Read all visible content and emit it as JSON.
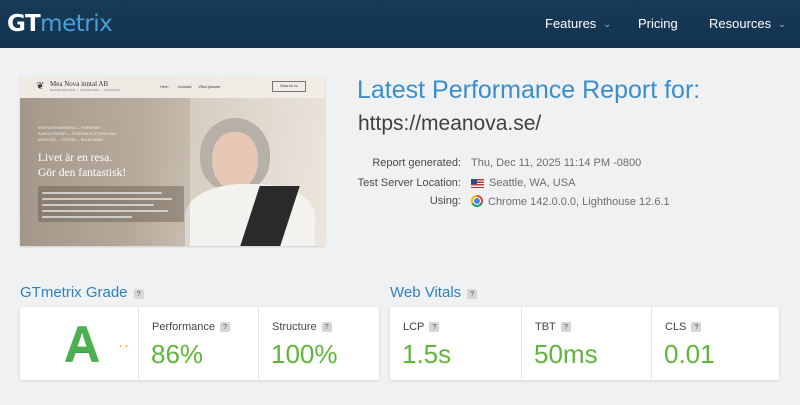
{
  "header": {
    "logo_gt": "GT",
    "logo_metrix": "metrix",
    "nav": [
      {
        "label": "Features",
        "has_dropdown": true
      },
      {
        "label": "Pricing",
        "has_dropdown": false
      },
      {
        "label": "Resources",
        "has_dropdown": true
      }
    ],
    "chevron": "⌄"
  },
  "thumbnail": {
    "site_name": "Mea Nova inntal AB",
    "tagline": "BARNFAMILJER — PERSONER — FAMILJER",
    "nav_items": [
      "Hem",
      "Kontakt",
      "Våra tjänster"
    ],
    "cta": "Boka tid nu",
    "small_lines": [
      "KONFLIKTHANTERING — PARTERAPI",
      "SAMTALSTERAPI — PERSONLIG UTVECKLING",
      "KRISSTÖD — STRESS — RELATIONER"
    ],
    "headline": "Livet är en resa.\nGör den fantastisk!"
  },
  "report": {
    "title": "Latest Performance Report for:",
    "url": "https://meanova.se/",
    "meta": [
      {
        "label": "Report generated:",
        "value": "Thu, Dec 11, 2025 11:14 PM -0800",
        "icon": ""
      },
      {
        "label": "Test Server Location:",
        "value": "Seattle, WA, USA",
        "icon": "us-flag-icon"
      },
      {
        "label": "Using:",
        "value": "Chrome 142.0.0.0, Lighthouse 12.6.1",
        "icon": "chrome-icon"
      }
    ]
  },
  "grade": {
    "title": "GTmetrix Grade",
    "help": "?",
    "letter": "A",
    "dots": "··",
    "performance_label": "Performance",
    "performance_value": "86%",
    "structure_label": "Structure",
    "structure_value": "100%"
  },
  "vitals": {
    "title": "Web Vitals",
    "help": "?",
    "items": [
      {
        "label": "LCP",
        "value": "1.5s"
      },
      {
        "label": "TBT",
        "value": "50ms"
      },
      {
        "label": "CLS",
        "value": "0.01"
      }
    ]
  },
  "colors": {
    "header_bg": "#173a57",
    "accent_blue": "#3a8ecb",
    "good_green": "#5fb63b",
    "grade_green": "#4caf50"
  }
}
